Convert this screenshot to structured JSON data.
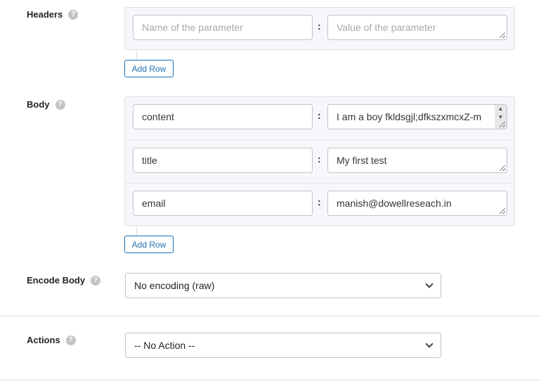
{
  "headers": {
    "label": "Headers",
    "help_icon": "question-icon",
    "name_placeholder": "Name of the parameter",
    "value_placeholder": "Value of the parameter",
    "add_row": "Add Row"
  },
  "body": {
    "label": "Body",
    "rows": [
      {
        "key": "content",
        "value": "I am a boy fkldsgjl;dfkszxmcxZ-m"
      },
      {
        "key": "title",
        "value": "My first test"
      },
      {
        "key": "email",
        "value": "manish@dowellreseach.in"
      }
    ],
    "separator": ":",
    "add_row": "Add Row"
  },
  "encode": {
    "label": "Encode Body",
    "value": "No encoding (raw)"
  },
  "actions": {
    "label": "Actions",
    "value": "-- No Action --"
  },
  "accent": "#2271b1"
}
